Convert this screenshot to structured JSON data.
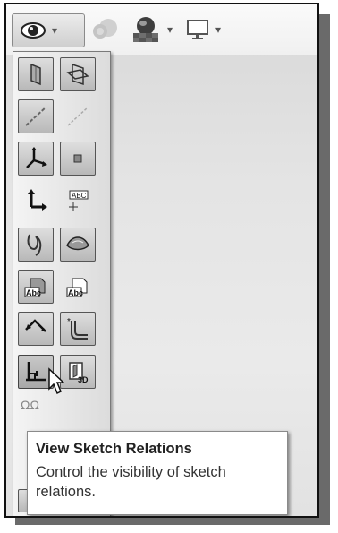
{
  "toolbar": {
    "items": [
      {
        "icon": "eye-icon",
        "caret": "▾"
      },
      {
        "icon": "appearance-sphere-icon"
      },
      {
        "icon": "scene-icon",
        "caret": "▾"
      },
      {
        "icon": "display-monitor-icon",
        "caret": "▾"
      }
    ]
  },
  "flyout": {
    "items": [
      {
        "icon": "view-planes-icon"
      },
      {
        "icon": "view-all-planes-icon"
      },
      {
        "icon": "view-axes-icon"
      },
      {
        "icon": "view-temporary-axes-icon"
      },
      {
        "icon": "view-coordinate-systems-icon"
      },
      {
        "icon": "view-points-icon"
      },
      {
        "icon": "view-origins-icon"
      },
      {
        "icon": "view-dimension-names-icon"
      },
      {
        "icon": "view-curves-icon"
      },
      {
        "icon": "view-surfaces-icon"
      },
      {
        "icon": "view-annotations-icon"
      },
      {
        "icon": "view-annotation-faces-icon"
      },
      {
        "icon": "view-sketch-dimensions-icon"
      },
      {
        "icon": "view-routing-points-icon"
      },
      {
        "icon": "view-sketch-relations-icon"
      },
      {
        "icon": "view-3d-sketch-planes-icon"
      }
    ],
    "partial_labels": {
      "row8_left": "ΩΩ"
    }
  },
  "tooltip": {
    "title": "View Sketch Relations",
    "description": "Control the visibility of sketch relations."
  }
}
